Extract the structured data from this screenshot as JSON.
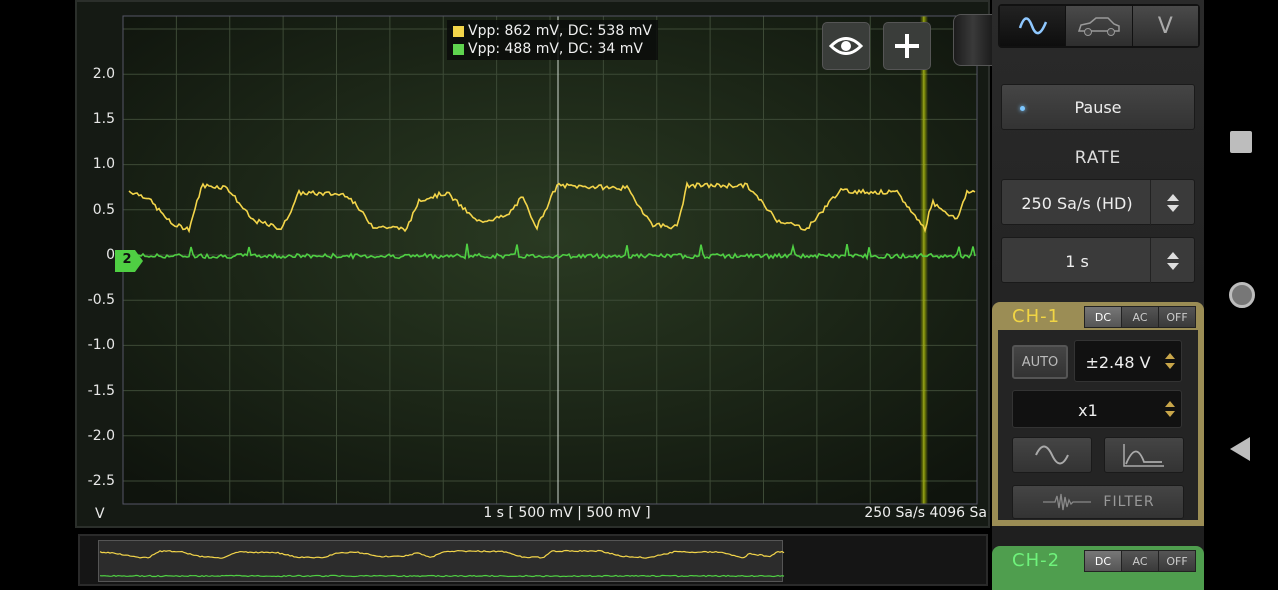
{
  "plot": {
    "y_ticks": [
      "2.0",
      "1.5",
      "1.0",
      "0.5",
      "0",
      "-0.5",
      "-1.0",
      "-1.5",
      "-2.0",
      "-2.5"
    ],
    "y_unit": "V",
    "bottom_center": "1 s  [ 500 mV | 500 mV ]",
    "bottom_right": "250 Sa/s   4096 Sa",
    "channel2_marker": "2"
  },
  "legend": {
    "ch1": {
      "text": "Vpp: 862 mV, DC: 538 mV",
      "color": "#f3d54a"
    },
    "ch2": {
      "text": "Vpp: 488 mV, DC: 34 mV",
      "color": "#5fd34f"
    }
  },
  "toolbar": {
    "eye_icon": "eye-icon",
    "plus_icon": "plus-icon"
  },
  "side": {
    "mode_tabs": [
      "scope-wave-icon",
      "car-icon",
      "V"
    ],
    "pause_label": "Pause",
    "rate_label": "RATE",
    "rate_value": "250 Sa/s (HD)",
    "time_value": "1 s"
  },
  "ch1": {
    "title": "CH-1",
    "modes": [
      "DC",
      "AC",
      "OFF"
    ],
    "auto_label": "AUTO",
    "range_value": "±2.48 V",
    "probe_value": "x1",
    "filter_label": "FILTER",
    "color": "#f1d544"
  },
  "ch2": {
    "title": "CH-2",
    "modes": [
      "DC",
      "AC",
      "OFF"
    ],
    "color": "#6ff27b"
  }
}
